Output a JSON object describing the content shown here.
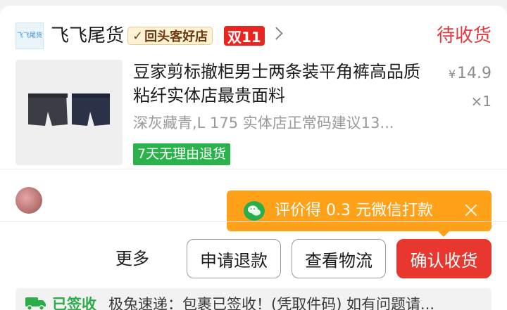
{
  "shop": {
    "logo_text": "飞飞尾货",
    "name": "飞飞尾货",
    "repeat_badge": "回头客好店",
    "double11_badge": "双11",
    "order_status": "待收货"
  },
  "product": {
    "title": "豆家剪标撤柜男士两条装平角裤高品质粘纤实体店最贵面料",
    "price_symbol": "¥",
    "price": "14.9",
    "quantity": "×1",
    "sku": "深灰藏青,L 175 实体店正常码建议13...",
    "return_tag": "7天无理由退货",
    "image_icon": "boxer-briefs-product-image",
    "colors": [
      "#3a3d44",
      "#2b3247"
    ]
  },
  "tip": {
    "text": "评价得 0.3 元微信打款",
    "icon": "wechat-icon",
    "close_icon": "close-icon"
  },
  "actions": {
    "more": "更多",
    "refund": "申请退款",
    "logistics": "查看物流",
    "confirm": "确认收货"
  },
  "logistics": {
    "icon": "truck-icon",
    "signed_label": "已签收",
    "text": "极兔速递：包裹已签收！(凭取件码) 如有问题请..."
  },
  "colors": {
    "accent_red": "#e8372f",
    "status_red": "#e4393c",
    "green": "#2bb24c",
    "tip_orange": "#ffa21a"
  }
}
